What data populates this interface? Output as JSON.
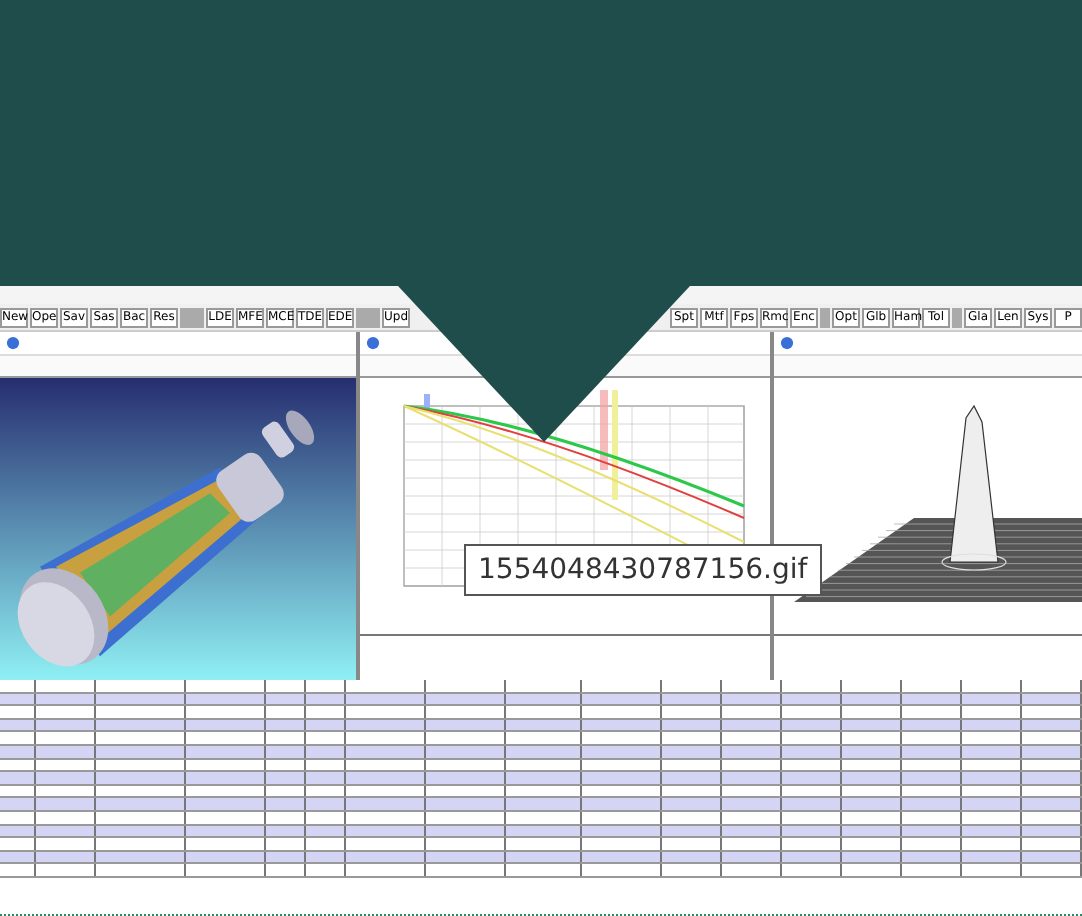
{
  "toolbar": {
    "left_buttons": [
      "New",
      "Ope",
      "Sav",
      "Sas",
      "Bac",
      "Res",
      "LDE",
      "MFE",
      "MCE",
      "TDE",
      "EDE",
      "Upd"
    ],
    "right_buttons": [
      "Spt",
      "Mtf",
      "Fps",
      "Rmc",
      "Enc",
      "Opt",
      "Glb",
      "Ham",
      "Tol",
      "Gla",
      "Len",
      "Sys",
      "P"
    ]
  },
  "tooltip": {
    "text": "1554048430787156.gif"
  }
}
